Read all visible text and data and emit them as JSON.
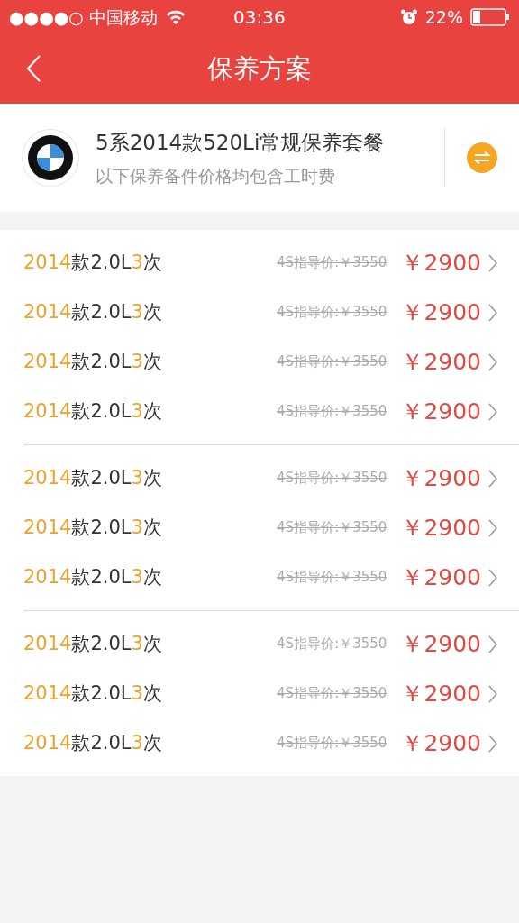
{
  "status_bar": {
    "carrier": "●●●●○ 中国移动",
    "time": "03:36",
    "battery": "22%"
  },
  "nav": {
    "title": "保养方案"
  },
  "header": {
    "title": "5系2014款520Li常规保养套餐",
    "subtitle": "以下保养备件价格均包含工时费"
  },
  "groups": [
    {
      "rows": [
        {
          "name": [
            {
              "text": "2014",
              "highlight": true
            },
            {
              "text": "款2.0L",
              "highlight": false
            },
            {
              "text": "3",
              "highlight": true
            },
            {
              "text": "次",
              "highlight": false
            }
          ],
          "guide_price": "4S指导价:￥3550",
          "price": "￥2900"
        },
        {
          "name": [
            {
              "text": "2014",
              "highlight": true
            },
            {
              "text": "款2.0L",
              "highlight": false
            },
            {
              "text": "3",
              "highlight": true
            },
            {
              "text": "次",
              "highlight": false
            }
          ],
          "guide_price": "4S指导价:￥3550",
          "price": "￥2900"
        },
        {
          "name": [
            {
              "text": "2014",
              "highlight": true
            },
            {
              "text": "款2.0L",
              "highlight": false
            },
            {
              "text": "3",
              "highlight": true
            },
            {
              "text": "次",
              "highlight": false
            }
          ],
          "guide_price": "4S指导价:￥3550",
          "price": "￥2900"
        },
        {
          "name": [
            {
              "text": "2014",
              "highlight": true
            },
            {
              "text": "款2.0L",
              "highlight": false
            },
            {
              "text": "3",
              "highlight": true
            },
            {
              "text": "次",
              "highlight": false
            }
          ],
          "guide_price": "4S指导价:￥3550",
          "price": "￥2900"
        }
      ]
    },
    {
      "rows": [
        {
          "name": [
            {
              "text": "2014",
              "highlight": true
            },
            {
              "text": "款2.0L",
              "highlight": false
            },
            {
              "text": "3",
              "highlight": true
            },
            {
              "text": "次",
              "highlight": false
            }
          ],
          "guide_price": "4S指导价:￥3550",
          "price": "￥2900"
        },
        {
          "name": [
            {
              "text": "2014",
              "highlight": true
            },
            {
              "text": "款2.0L",
              "highlight": false
            },
            {
              "text": "3",
              "highlight": true
            },
            {
              "text": "次",
              "highlight": false
            }
          ],
          "guide_price": "4S指导价:￥3550",
          "price": "￥2900"
        },
        {
          "name": [
            {
              "text": "2014",
              "highlight": true
            },
            {
              "text": "款2.0L",
              "highlight": false
            },
            {
              "text": "3",
              "highlight": true
            },
            {
              "text": "次",
              "highlight": false
            }
          ],
          "guide_price": "4S指导价:￥3550",
          "price": "￥2900"
        }
      ]
    },
    {
      "rows": [
        {
          "name": [
            {
              "text": "2014",
              "highlight": true
            },
            {
              "text": "款2.0L",
              "highlight": false
            },
            {
              "text": "3",
              "highlight": true
            },
            {
              "text": "次",
              "highlight": false
            }
          ],
          "guide_price": "4S指导价:￥3550",
          "price": "￥2900"
        },
        {
          "name": [
            {
              "text": "2014",
              "highlight": true
            },
            {
              "text": "款2.0L",
              "highlight": false
            },
            {
              "text": "3",
              "highlight": true
            },
            {
              "text": "次",
              "highlight": false
            }
          ],
          "guide_price": "4S指导价:￥3550",
          "price": "￥2900"
        },
        {
          "name": [
            {
              "text": "2014",
              "highlight": true
            },
            {
              "text": "款2.0L",
              "highlight": false
            },
            {
              "text": "3",
              "highlight": true
            },
            {
              "text": "次",
              "highlight": false
            }
          ],
          "guide_price": "4S指导价:￥3550",
          "price": "￥2900"
        }
      ]
    }
  ]
}
